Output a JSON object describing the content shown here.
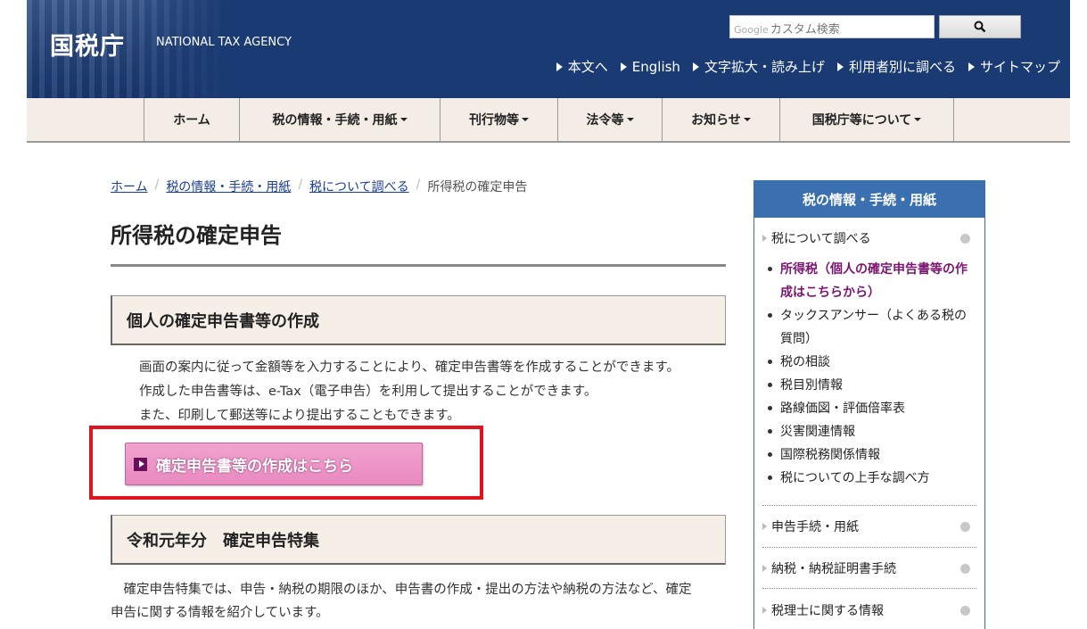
{
  "header": {
    "logo_jp": "国税庁",
    "logo_en": "NATIONAL TAX AGENCY",
    "search_placeholder_brand": "Google",
    "search_placeholder": "カスタム検索",
    "search_button_icon": "search-icon",
    "util_links": [
      "本文へ",
      "English",
      "文字拡大・読み上げ",
      "利用者別に調べる",
      "サイトマップ"
    ]
  },
  "nav": {
    "items": [
      "ホーム",
      "税の情報・手続・用紙",
      "刊行物等",
      "法令等",
      "お知らせ",
      "国税庁等について"
    ]
  },
  "breadcrumb": {
    "items": [
      "ホーム",
      "税の情報・手続・用紙",
      "税について調べる",
      "所得税の確定申告"
    ]
  },
  "main": {
    "title": "所得税の確定申告",
    "section1": {
      "heading": "個人の確定申告書等の作成",
      "lines": [
        "画面の案内に従って金額等を入力することにより、確定申告書等を作成することができます。",
        "作成した申告書等は、e-Tax（電子申告）を利用して提出することができます。",
        "また、印刷して郵送等により提出することもできます。"
      ],
      "button_label": "確定申告書等の作成はこちら"
    },
    "section2": {
      "heading": "令和元年分　確定申告特集",
      "lines": [
        "　確定申告特集では、申告・納税の期限のほか、申告書の作成・提出の方法や納税の方法など、確定",
        "申告に関する情報を紹介しています。"
      ]
    }
  },
  "sidebar": {
    "heading": "税の情報・手続・用紙",
    "top_link": "税について調べる",
    "list": [
      "所得税（個人の確定申告書等の作成はこちらから）",
      "タックスアンサー（よくある税の質問）",
      "税の相談",
      "税目別情報",
      "路線価図・評価倍率表",
      "災害関連情報",
      "国際税務関係情報",
      "税についての上手な調べ方"
    ],
    "bottom_links": [
      "申告手続・用紙",
      "納税・納税証明書手続",
      "税理士に関する情報"
    ]
  },
  "colors": {
    "header_bg": "#1a3a73",
    "nav_bg": "#f3ede6",
    "sidebar_accent": "#3a6fb0",
    "cta_bg": "#e889c0",
    "highlight_border": "#e0141e",
    "active_link": "#7b1570"
  }
}
